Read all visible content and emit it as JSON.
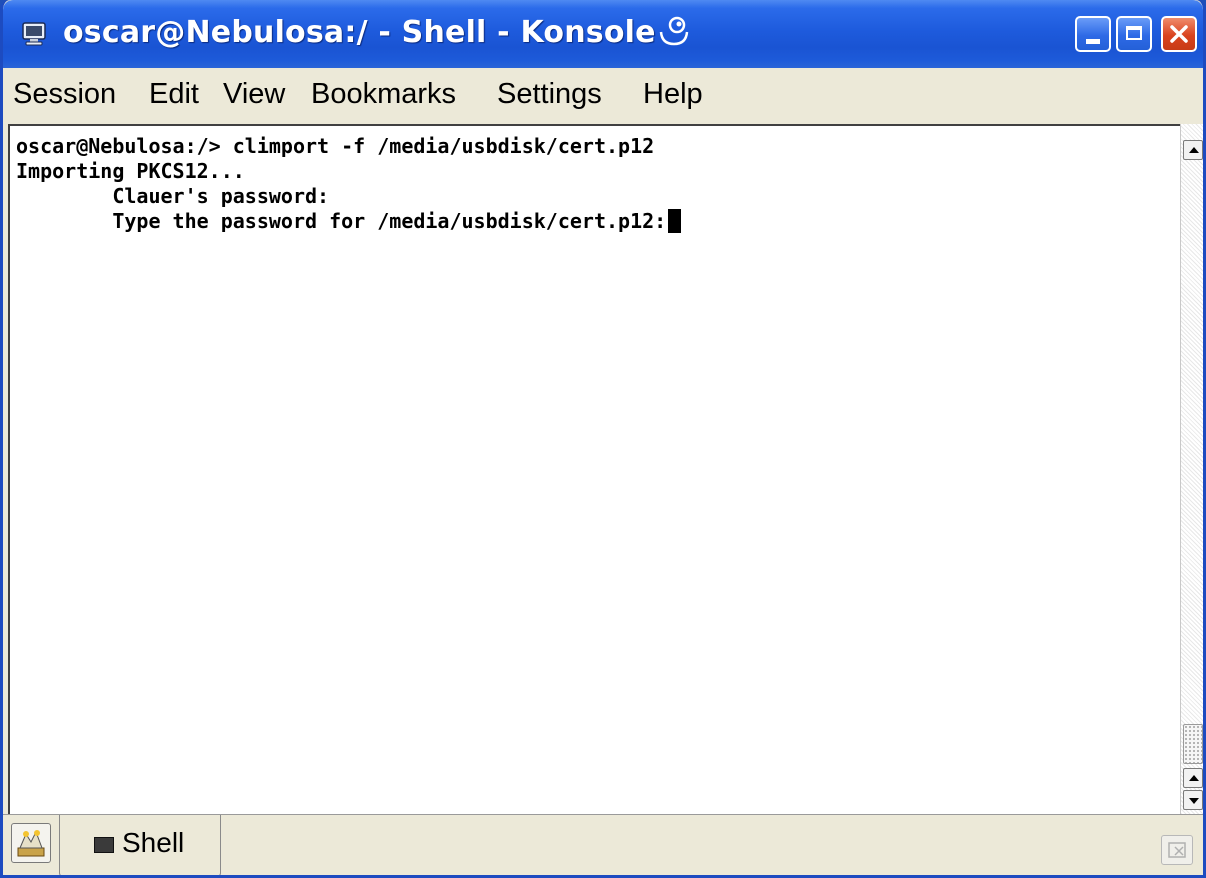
{
  "window": {
    "title": "oscar@Nebulosa:/ - Shell - Konsole",
    "accent": "#1e5bdd",
    "close_color": "#d9431e"
  },
  "menu": {
    "items": [
      "Session",
      "Edit",
      "View",
      "Bookmarks",
      "Settings",
      "Help"
    ]
  },
  "terminal": {
    "lines": [
      "oscar@Nebulosa:/> climport -f /media/usbdisk/cert.p12",
      "Importing PKCS12...",
      "        Clauer's password:",
      "        Type the password for /media/usbdisk/cert.p12:"
    ],
    "background": "#ffffff",
    "foreground": "#000000"
  },
  "tabs": {
    "items": [
      {
        "label": "Shell",
        "icon": "terminal-icon",
        "active": true
      }
    ],
    "new_tab_icon": "new-session-icon",
    "close_tab_icon": "close-session-icon"
  }
}
